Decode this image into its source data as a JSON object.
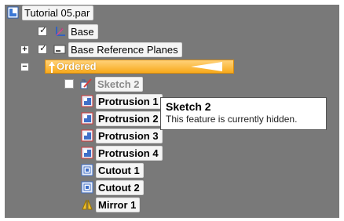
{
  "tree": {
    "root": {
      "label": "Tutorial 05.par",
      "icon": "part-document-icon"
    },
    "base": {
      "label": "Base",
      "checked": true,
      "icon": "coordinate-system-icon"
    },
    "base_reference_planes": {
      "label": "Base Reference Planes",
      "checked": true,
      "expander": "+",
      "icon": "reference-plane-icon"
    },
    "ordered": {
      "label": "Ordered",
      "expander": "−",
      "icon": "ordered-icon",
      "highlight_color": "#f8a91a"
    },
    "features": [
      {
        "label": "Sketch 2",
        "icon": "sketch-icon",
        "hidden": true
      },
      {
        "label": "Protrusion 1",
        "icon": "protrusion-icon"
      },
      {
        "label": "Protrusion 2",
        "icon": "protrusion-icon"
      },
      {
        "label": "Protrusion 3",
        "icon": "protrusion-icon"
      },
      {
        "label": "Protrusion 4",
        "icon": "protrusion-icon"
      },
      {
        "label": "Cutout 1",
        "icon": "cutout-icon"
      },
      {
        "label": "Cutout 2",
        "icon": "cutout-icon"
      },
      {
        "label": "Mirror 1",
        "icon": "mirror-icon"
      }
    ]
  },
  "tooltip": {
    "title": "Sketch 2",
    "body": "This feature is currently hidden."
  }
}
